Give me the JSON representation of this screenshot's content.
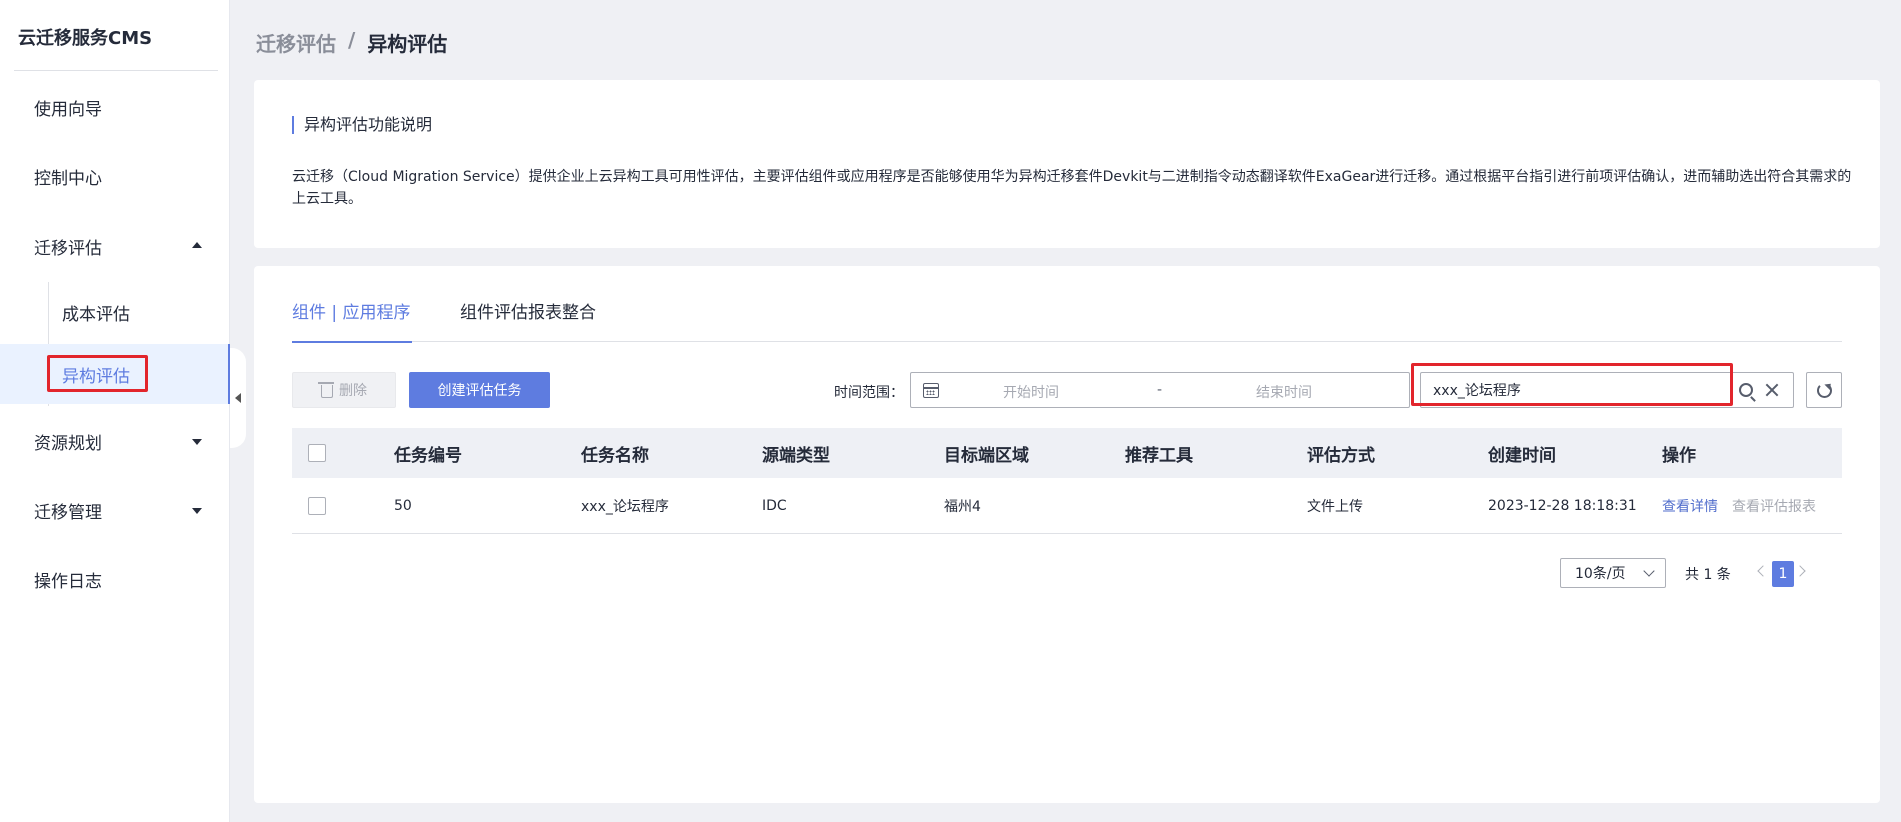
{
  "sidebar": {
    "brand": "云迁移服务CMS",
    "items": [
      {
        "label": "使用向导"
      },
      {
        "label": "控制中心"
      },
      {
        "label": "迁移评估"
      },
      {
        "label": "资源规划"
      },
      {
        "label": "迁移管理"
      },
      {
        "label": "操作日志"
      }
    ],
    "sub_items": [
      {
        "label": "成本评估"
      },
      {
        "label": "异构评估"
      }
    ]
  },
  "breadcrumb": {
    "parent": "迁移评估",
    "separator": "/",
    "current": "异构评估"
  },
  "info": {
    "title": "异构评估功能说明",
    "description": "云迁移（Cloud Migration Service）提供企业上云异构工具可用性评估，主要评估组件或应用程序是否能够使用华为异构迁移套件Devkit与二进制指令动态翻译软件ExaGear进行迁移。通过根据平台指引进行前项评估确认，进而辅助选出符合其需求的上云工具。"
  },
  "tabs": [
    {
      "label": "组件 | 应用程序"
    },
    {
      "label": "组件评估报表整合"
    }
  ],
  "toolbar": {
    "delete_label": "删除",
    "create_label": "创建评估任务",
    "range_label": "时间范围：",
    "start_placeholder": "开始时间",
    "range_sep": "-",
    "end_placeholder": "结束时间",
    "search_value": "xxx_论坛程序"
  },
  "table": {
    "columns": [
      "任务编号",
      "任务名称",
      "源端类型",
      "目标端区域",
      "推荐工具",
      "评估方式",
      "创建时间",
      "操作"
    ],
    "rows": [
      {
        "id": "50",
        "name": "xxx_论坛程序",
        "source_type": "IDC",
        "target_region": "福州4",
        "tool": "",
        "method": "文件上传",
        "created": "2023-12-28 18:18:31",
        "action_detail": "查看详情",
        "action_report": "查看评估报表"
      }
    ]
  },
  "pagination": {
    "page_size": "10条/页",
    "total": "共 1 条",
    "current_page": "1"
  },
  "colors": {
    "accent": "#5e7ce0",
    "highlight": "#e2252c"
  }
}
